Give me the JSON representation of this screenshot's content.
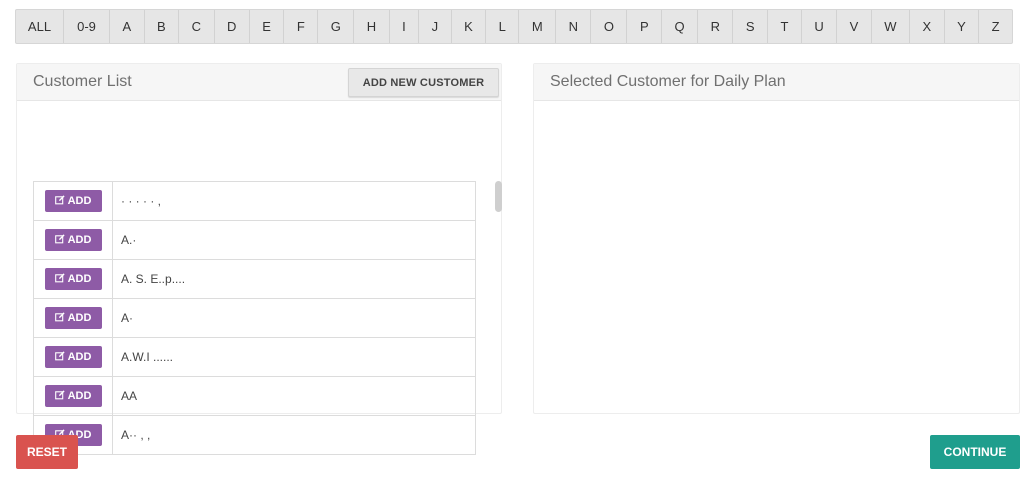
{
  "alphabet": [
    "ALL",
    "0-9",
    "A",
    "B",
    "C",
    "D",
    "E",
    "F",
    "G",
    "H",
    "I",
    "J",
    "K",
    "L",
    "M",
    "N",
    "O",
    "P",
    "Q",
    "R",
    "S",
    "T",
    "U",
    "V",
    "W",
    "X",
    "Y",
    "Z"
  ],
  "customer_panel": {
    "title": "Customer List",
    "add_new_label": "ADD NEW CUSTOMER"
  },
  "customers": [
    {
      "add_label": "ADD",
      "icon": "edit-icon",
      "name": "· · · · · ,"
    },
    {
      "add_label": "ADD",
      "icon": "edit-icon",
      "name": "A.·"
    },
    {
      "add_label": "ADD",
      "icon": "edit-icon",
      "name": "A. S. E..p...."
    },
    {
      "add_label": "ADD",
      "icon": "edit-icon",
      "name": "A·"
    },
    {
      "add_label": "ADD",
      "icon": "edit-icon",
      "name": "A.W.I ......"
    },
    {
      "add_label": "ADD",
      "icon": "edit-icon",
      "name": "AA"
    },
    {
      "add_label": "ADD",
      "icon": "edit-icon",
      "name": "A·· , ,"
    }
  ],
  "selected_panel": {
    "title": "Selected Customer for Daily Plan"
  },
  "actions": {
    "reset_label": "RESET",
    "continue_label": "CONTINUE"
  },
  "colors": {
    "add_button": "#8e5ba6",
    "reset_button": "#d9534f",
    "continue_button": "#1f9e8d"
  }
}
